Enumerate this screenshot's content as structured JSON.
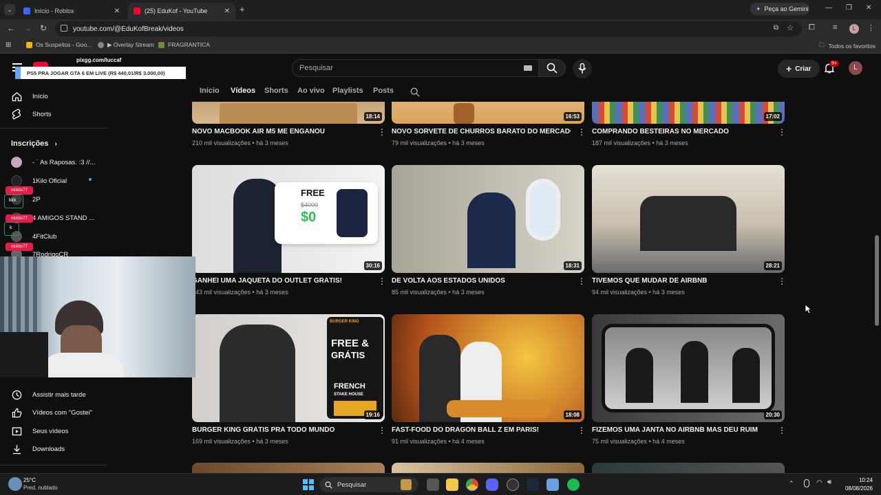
{
  "browser": {
    "tabs": [
      {
        "title": "Início - Roblox",
        "active": false
      },
      {
        "title": "(25) EduKof - YouTube",
        "active": true
      }
    ],
    "gemini_button": "Peça ao Gemini",
    "url": "youtube.com/@EduKofBreak/videos",
    "profile_initial": "L",
    "bookmarks": [
      "Os Suspeitos - Goo...",
      "▶ Overlay Stream",
      "FRAGRANTICA"
    ],
    "all_favorites": "Todos os favoritos"
  },
  "youtube": {
    "search_placeholder": "Pesquisar",
    "create_label": "Criar",
    "notifications_badge": "9+",
    "avatar_initial": "L",
    "channel_tabs": [
      {
        "label": "Início",
        "active": false
      },
      {
        "label": "Vídeos",
        "active": true
      },
      {
        "label": "Shorts",
        "active": false
      },
      {
        "label": "Ao vivo",
        "active": false
      },
      {
        "label": "Playlists",
        "active": false
      },
      {
        "label": "Posts",
        "active": false
      }
    ]
  },
  "sidebar": {
    "top": [
      {
        "label": "Início",
        "icon": "home-icon"
      },
      {
        "label": "Shorts",
        "icon": "shorts-icon"
      }
    ],
    "subscriptions_header": "Inscrições",
    "subscriptions": [
      {
        "label": "- ˙ As Raposas. :3 //...",
        "color": "#c7a8c2"
      },
      {
        "label": "1Kilo Oficial",
        "color": "#222222",
        "dot": true
      },
      {
        "label": "2P",
        "color": "#3a3a3a"
      },
      {
        "label": "4 AMIGOS STAND ...",
        "color": "#444444"
      },
      {
        "label": "4FitClub",
        "color": "#555555"
      },
      {
        "label": "7RodrigoCR",
        "color": "#666666"
      }
    ],
    "you": [
      {
        "label": "Assistir mais tarde",
        "icon": "clock-icon"
      },
      {
        "label": "Vídeos com \"Gostei\"",
        "icon": "thumbs-up-icon"
      },
      {
        "label": "Seus vídeos",
        "icon": "play-square-icon"
      },
      {
        "label": "Downloads",
        "icon": "download-icon"
      }
    ]
  },
  "videos": [
    {
      "title": "NOVO MACBOOK AIR M5 ME ENGANOU",
      "meta": "210 mil visualizações • há 3 meses",
      "duration": "18:14",
      "bg": "#c9a67a"
    },
    {
      "title": "NOVO SORVETE DE CHURROS BARATO DO MERCADO",
      "meta": "79 mil visualizações • há 3 meses",
      "duration": "16:53",
      "bg": "#d9a35a"
    },
    {
      "title": "COMPRANDO BESTEIRAS NO MERCADO",
      "meta": "187 mil visualizações • há 3 meses",
      "duration": "17:02",
      "bg": "#7b86a8"
    },
    {
      "title": "GANHEI UMA JAQUETA DO OUTLET GRÁTIS!",
      "meta": "143 mil visualizações • há 3 meses",
      "duration": "30:16",
      "bg": "#e9e9ec"
    },
    {
      "title": "DE VOLTA AOS ESTADOS UNIDOS",
      "meta": "85 mil visualizações • há 3 meses",
      "duration": "18:31",
      "bg": "#b8b4a6"
    },
    {
      "title": "TIVEMOS QUE MUDAR DE AIRBNB",
      "meta": "94 mil visualizações • há 3 meses",
      "duration": "28:21",
      "bg": "#8b8e95"
    },
    {
      "title": "BURGER KING GRÁTIS PRA TODO MUNDO",
      "meta": "169 mil visualizações • há 3 meses",
      "duration": "19:16",
      "bg": "#d8d3cf"
    },
    {
      "title": "FAST-FOOD DO DRAGON BALL Z EM PARIS!",
      "meta": "91 mil visualizações • há 4 meses",
      "duration": "18:08",
      "bg": "#c77a2a"
    },
    {
      "title": "FIZEMOS UMA JANTA NO AIRBNB MAS DEU RUIM",
      "meta": "75 mil visualizações • há 4 meses",
      "duration": "20:30",
      "bg": "#5a5a5a"
    }
  ],
  "thumb_text": {
    "free": "FREE",
    "old_price": "$4000",
    "new_price": "$0",
    "bk_free": "FREE &",
    "bk_gratis": "GRÁTIS",
    "bk_french": "FRENCH",
    "bk_steak": "STAKE HOUSE",
    "bk_brand": "BURGER KING"
  },
  "stream_overlay": {
    "pix": "pixgg.com/luccaf",
    "banner": "PS5 PRA JOGAR GTA 6 EM LIVE (R$ 440,01/R$ 3.000,00)",
    "nick1": "nickbs77",
    "nick2": "nickbs77",
    "nick3": "nickbs77",
    "kk": "kkk",
    "k": "k"
  },
  "taskbar": {
    "weather_temp": "25°C",
    "weather_desc": "Pred. nublado",
    "search_label": "Pesquisar",
    "time": "10:24",
    "date": "08/08/2026"
  }
}
